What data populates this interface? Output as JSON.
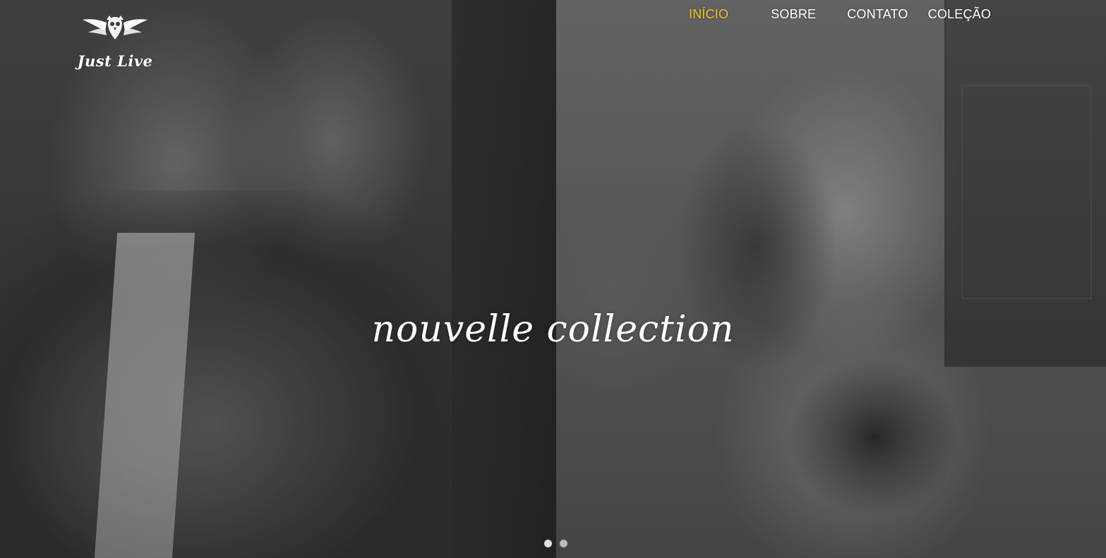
{
  "brand": {
    "name": "Just Live",
    "logo_icon": "owl-icon"
  },
  "nav": {
    "items": [
      {
        "label": "INÍCIO",
        "active": true
      },
      {
        "label": "SOBRE",
        "active": false
      },
      {
        "label": "CONTATO",
        "active": false
      },
      {
        "label": "COLEÇÃO",
        "active": false
      }
    ],
    "active_color": "#f0c425",
    "text_color": "#ffffff"
  },
  "hero": {
    "headline": "nouvelle collection",
    "slides": [
      {
        "active": true
      },
      {
        "active": false
      }
    ]
  }
}
